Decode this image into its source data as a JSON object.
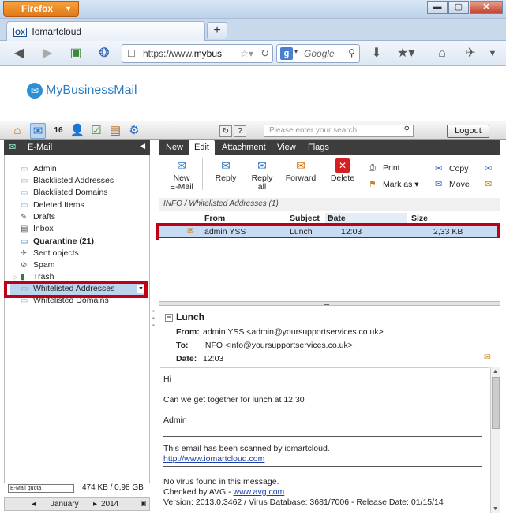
{
  "browser": {
    "app_button": "Firefox",
    "tab_title": "Iomartcloud",
    "tab_badge": "OX",
    "url_prefix": "https://www.",
    "url_domain": "mybus",
    "search_placeholder": "Google"
  },
  "brand": {
    "name": "MyBusinessMail"
  },
  "app_toolbar": {
    "search_placeholder": "Please enter your search",
    "logout": "Logout"
  },
  "sidebar": {
    "title": "E-Mail",
    "folders": [
      {
        "label": "Admin"
      },
      {
        "label": "Blacklisted Addresses"
      },
      {
        "label": "Blacklisted Domains"
      },
      {
        "label": "Deleted Items"
      },
      {
        "label": "Drafts"
      },
      {
        "label": "Inbox"
      },
      {
        "label": "Quarantine (21)"
      },
      {
        "label": "Sent objects"
      },
      {
        "label": "Spam"
      },
      {
        "label": "Trash"
      },
      {
        "label": "Whitelisted Addresses"
      },
      {
        "label": "Whitelisted Domains"
      }
    ],
    "quota_label": "E-Mail quota",
    "quota_value": "474 KB / 0,98 GB",
    "calendar_month": "January",
    "calendar_year": "2014"
  },
  "tabs": [
    "New",
    "Edit",
    "Attachment",
    "View",
    "Flags"
  ],
  "ribbon": {
    "new_email": "New\nE-Mail",
    "reply": "Reply",
    "reply_all": "Reply\nall",
    "forward": "Forward",
    "delete": "Delete",
    "print": "Print",
    "mark_as": "Mark as",
    "copy": "Copy",
    "move": "Move"
  },
  "list": {
    "breadcrumb": "INFO / Whitelisted Addresses (1)",
    "columns": {
      "from": "From",
      "subject": "Subject",
      "date": "Date",
      "size": "Size"
    },
    "rows": [
      {
        "from": "admin YSS",
        "subject": "Lunch",
        "date": "12:03",
        "size": "2,33 KB"
      }
    ]
  },
  "preview": {
    "subject": "Lunch",
    "from_label": "From:",
    "from": "admin YSS <admin@yoursupportservices.co.uk>",
    "to_label": "To:",
    "to": "INFO <info@yoursupportservices.co.uk>",
    "date_label": "Date:",
    "date": "12:03",
    "body": {
      "greeting": "Hi",
      "line1": "Can we get together for lunch at 12:30",
      "signature": "Admin",
      "scan_notice": "This email has been scanned by iomartcloud.",
      "scan_link": "http://www.iomartcloud.com",
      "virus_line1": "No virus found in this message.",
      "virus_line2_prefix": "Checked by AVG - ",
      "virus_link": "www.avg.com",
      "virus_line3": "Version: 2013.0.3462 / Virus Database: 3681/7006 - Release Date: 01/15/14"
    }
  }
}
